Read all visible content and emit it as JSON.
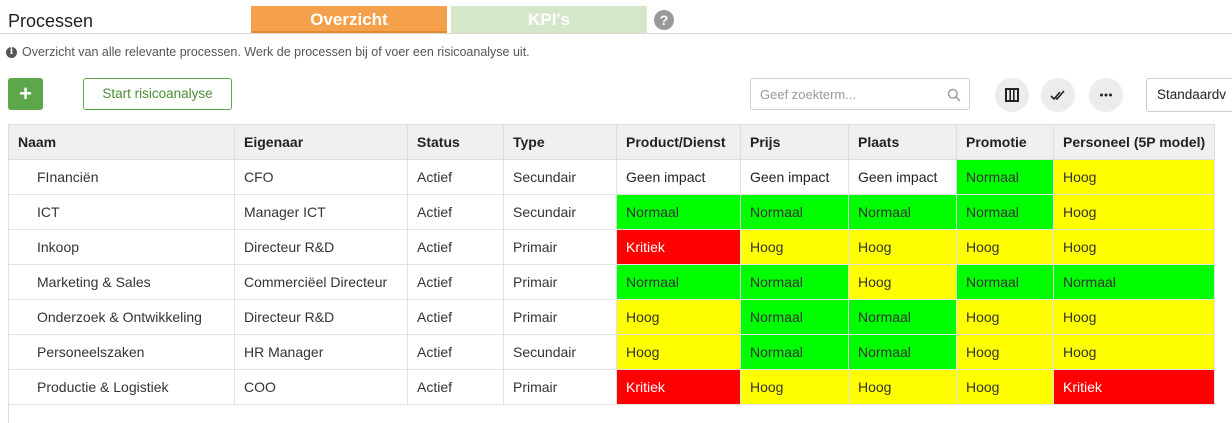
{
  "header": {
    "title": "Processen",
    "tabs": [
      {
        "label": "Overzicht",
        "active": true
      },
      {
        "label": "KPI's",
        "active": false
      }
    ]
  },
  "info_text": "Overzicht van alle relevante processen. Werk de processen bij of voer een risicoanalyse uit.",
  "toolbar": {
    "add_label": "+",
    "start_label": "Start risicoanalyse",
    "search_placeholder": "Geef zoekterm...",
    "view_label": "Standaardv"
  },
  "colors": {
    "accent": "#f5a04a",
    "kpi_tab": "#d4e7c9",
    "primary_green": "#5ea64a",
    "critical": "#ff0000",
    "high": "#ffff00",
    "normal": "#00ff00"
  },
  "table": {
    "columns": [
      "Naam",
      "Eigenaar",
      "Status",
      "Type",
      "Product/Dienst",
      "Prijs",
      "Plaats",
      "Promotie",
      "Personeel (5P model)"
    ],
    "rows": [
      [
        "FInanciën",
        "CFO",
        "Actief",
        "Secundair",
        "Geen impact",
        "Geen impact",
        "Geen impact",
        "Normaal",
        "Hoog"
      ],
      [
        "ICT",
        "Manager ICT",
        "Actief",
        "Secundair",
        "Normaal",
        "Normaal",
        "Normaal",
        "Normaal",
        "Hoog"
      ],
      [
        "Inkoop",
        "Directeur R&D",
        "Actief",
        "Primair",
        "Kritiek",
        "Hoog",
        "Hoog",
        "Hoog",
        "Hoog"
      ],
      [
        "Marketing & Sales",
        "Commerciëel Directeur",
        "Actief",
        "Primair",
        "Normaal",
        "Normaal",
        "Hoog",
        "Normaal",
        "Normaal"
      ],
      [
        "Onderzoek & Ontwikkeling",
        "Directeur R&D",
        "Actief",
        "Primair",
        "Hoog",
        "Normaal",
        "Normaal",
        "Hoog",
        "Hoog"
      ],
      [
        "Personeelszaken",
        "HR Manager",
        "Actief",
        "Secundair",
        "Hoog",
        "Normaal",
        "Normaal",
        "Hoog",
        "Hoog"
      ],
      [
        "Productie & Logistiek",
        "COO",
        "Actief",
        "Primair",
        "Kritiek",
        "Hoog",
        "Hoog",
        "Hoog",
        "Kritiek"
      ]
    ]
  }
}
